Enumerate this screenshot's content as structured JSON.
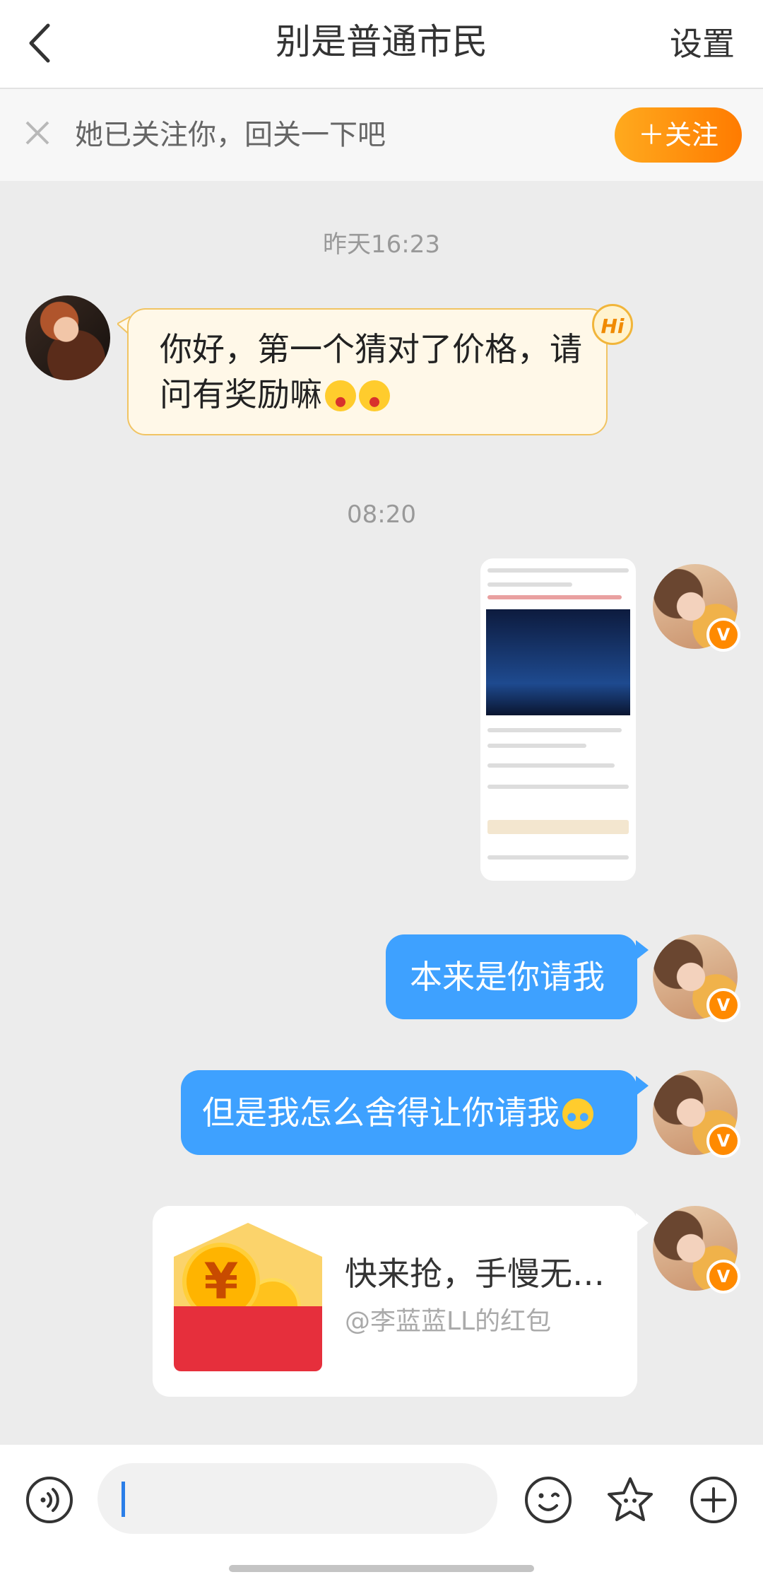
{
  "header": {
    "title": "别是普通市民",
    "settings_label": "设置"
  },
  "follow_banner": {
    "text": "她已关注你，回关一下吧",
    "button_label": "＋关注"
  },
  "messages": {
    "time1": "昨天16:23",
    "incoming_text": "你好，第一个猜对了价格，请问有奖励嘛",
    "hi_badge": "Hi",
    "time2": "08:20",
    "out1": "本来是你请我",
    "out2": "但是我怎么舍得让你请我",
    "redpacket_title": "快来抢，手慢无…",
    "redpacket_sub": "@李蓝蓝LL的红包",
    "currency_symbol": "¥",
    "verified_badge": "V"
  },
  "colors": {
    "accent_orange": "#ff8a00",
    "bubble_blue": "#3ea1ff",
    "red_packet": "#e62f3c"
  },
  "icons": [
    "back-icon",
    "close-icon",
    "voice-icon",
    "emoji-icon",
    "sticker-icon",
    "plus-icon"
  ]
}
